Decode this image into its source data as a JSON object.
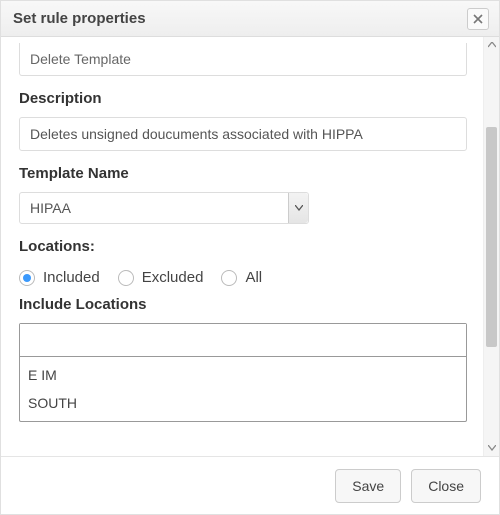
{
  "header": {
    "title": "Set rule properties"
  },
  "fields": {
    "name_value": "Delete Template",
    "description_label": "Description",
    "description_value": "Deletes unsigned doucuments associated with HIPPA",
    "template_label": "Template Name",
    "template_value": "HIPAA",
    "locations_label": "Locations:",
    "include_locations_label": "Include Locations"
  },
  "radios": {
    "options": [
      {
        "label": "Included",
        "selected": true
      },
      {
        "label": "Excluded",
        "selected": false
      },
      {
        "label": "All",
        "selected": false
      }
    ]
  },
  "include_locations": {
    "filter_value": "",
    "items": [
      "E IM",
      "SOUTH"
    ]
  },
  "footer": {
    "save": "Save",
    "close": "Close"
  }
}
